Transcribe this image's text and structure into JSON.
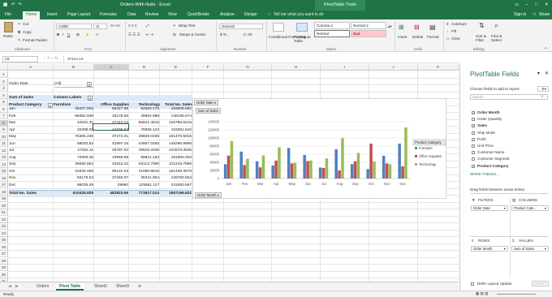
{
  "window": {
    "title": "Orders-With Nulls - Excel",
    "context_tab": "PivotTable Tools",
    "signin": "Sign in",
    "share": "Share"
  },
  "tabs": [
    "File",
    "Home",
    "Insert",
    "Page Layout",
    "Formulas",
    "Data",
    "Review",
    "View",
    "QuickBooks",
    "Analyze",
    "Design"
  ],
  "tell_me": "Tell me what you want to do",
  "ribbon": {
    "clipboard": {
      "paste": "Paste",
      "cut": "Cut",
      "copy": "Copy",
      "format_painter": "Format Painter",
      "group": "Clipboard"
    },
    "font": {
      "name": "Calibri",
      "size": "11",
      "group": "Font"
    },
    "alignment": {
      "wrap": "Wrap Text",
      "merge": "Merge & Center",
      "group": "Alignment"
    },
    "number": {
      "format": "General",
      "group": "Number"
    },
    "styles": {
      "cf": "Conditional Formatting",
      "fat": "Format as Table",
      "comma": "Comma 2",
      "normal2": "Normal 2",
      "normal": "Normal",
      "bad": "Bad",
      "group": "Styles"
    },
    "cells": {
      "insert": "Insert",
      "delete": "Delete",
      "format": "Format",
      "group": "Cells"
    },
    "editing": {
      "autosum": "AutoSum",
      "fill": "Fill",
      "clear": "Clear",
      "sort": "Sort & Filter",
      "find": "Find & Select",
      "group": "Editing"
    }
  },
  "formula_bar": {
    "name_box": "C8",
    "value": "27414.13"
  },
  "columns": [
    "A",
    "B",
    "C",
    "D",
    "E",
    "F",
    "G",
    "H",
    "I",
    "J",
    "K"
  ],
  "rows": [
    "1",
    "2",
    "3",
    "4",
    "5",
    "6",
    "7",
    "8",
    "9",
    "10",
    "11",
    "12",
    "13",
    "14",
    "15",
    "16",
    "17",
    "18",
    "19",
    "20",
    "21",
    "22",
    "23",
    "24",
    "25",
    "26",
    "27",
    "28",
    "29",
    "30",
    "31",
    "32"
  ],
  "pivot": {
    "filter_label": "Order Date",
    "filter_value": "(All)",
    "sum_label": "Sum of Sales",
    "col_labels": "Column Labels",
    "row_label": "Product Category",
    "headers": [
      "Furniture",
      "Office Supplies",
      "Technology",
      "Total No. Sales"
    ],
    "data": [
      [
        "Jan",
        "35407.806",
        "56417.68",
        "92683.176",
        "184508.662"
      ],
      [
        "Feb",
        "66362.936",
        "33178.55",
        "48654.088",
        "148195.574"
      ],
      [
        "Mar",
        "42531.31",
        "27414.13",
        "56841.4615",
        "126786.9215"
      ],
      [
        "Apr",
        "32289.09",
        "44206.63",
        "76906.122",
        "153381.842"
      ],
      [
        "May",
        "75365.236",
        "37274.31",
        "38839.0455",
        "151478.5915"
      ],
      [
        "Jun",
        "58032.82",
        "42897.15",
        "44567.0265",
        "145296.9965"
      ],
      [
        "Jul",
        "27282.11",
        "25787.04",
        "49529.2035",
        "102578.3535"
      ],
      [
        "Aug",
        "72059.46",
        "19969.68",
        "99821.153",
        "191850.293"
      ],
      [
        "Sep",
        "35592.664",
        "42513.42",
        "63112.7055",
        "141218.7895"
      ],
      [
        "Oct",
        "23330.466",
        "86122.03",
        "41986.8615",
        "151439.3575"
      ],
      [
        "Nov",
        "56176.53",
        "37283.07",
        "35321.054",
        "128780.654"
      ],
      [
        "Dec",
        "86035.48",
        "29960",
        "125651.117",
        "241650.597"
      ]
    ],
    "total": [
      "Total No. Sales",
      "610425.928",
      "482823.69",
      "773917.014",
      "1867166.632"
    ]
  },
  "chart_data": {
    "type": "bar",
    "title": "",
    "filter_buttons": [
      "Order Date",
      "Sum of Sales"
    ],
    "axis_button": "Order Month",
    "legend_title": "Product Category",
    "legend_position": "right",
    "categories": [
      "Jan",
      "Feb",
      "Mar",
      "Apr",
      "May",
      "Jun",
      "Jul",
      "Aug",
      "Sep",
      "Oct",
      "Nov",
      "Dec"
    ],
    "ylim": [
      0,
      140000
    ],
    "yticks": [
      "0",
      "20000",
      "40000",
      "60000",
      "80000",
      "100000",
      "120000",
      "140000"
    ],
    "series": [
      {
        "name": "Furniture",
        "color": "#4f81bd",
        "values": [
          35407.806,
          66362.936,
          42531.31,
          32289.09,
          75365.236,
          58032.82,
          27282.11,
          72059.46,
          35592.664,
          23330.466,
          56176.53,
          86035.48
        ]
      },
      {
        "name": "Office Supplies",
        "color": "#c0504d",
        "values": [
          56417.68,
          33178.55,
          27414.13,
          44206.63,
          37274.31,
          42897.15,
          25787.04,
          19969.68,
          42513.42,
          86122.03,
          37283.07,
          29960
        ]
      },
      {
        "name": "Technology",
        "color": "#9bbb59",
        "values": [
          92683.176,
          48654.088,
          56841.4615,
          76906.122,
          38839.0455,
          44567.0265,
          49529.2035,
          99821.153,
          63112.7055,
          41986.8615,
          35321.054,
          125651.117
        ]
      }
    ]
  },
  "sheets": [
    "Orders",
    "Pivot Table",
    "Sheet2",
    "Sheet3"
  ],
  "active_sheet": 1,
  "status": "Ready",
  "pane": {
    "title": "PivotTable Fields",
    "subtitle": "Choose fields to add to report:",
    "search_placeholder": "Search",
    "fields": [
      {
        "name": "Order Month",
        "checked": true
      },
      {
        "name": "Order Quantity",
        "checked": false
      },
      {
        "name": "Sales",
        "checked": true
      },
      {
        "name": "Ship Mode",
        "checked": false
      },
      {
        "name": "Profit",
        "checked": false
      },
      {
        "name": "Unit Price",
        "checked": false
      },
      {
        "name": "Customer Name",
        "checked": false
      },
      {
        "name": "Customer Segment",
        "checked": false
      },
      {
        "name": "Product Category",
        "checked": true
      }
    ],
    "more_tables": "MORE TABLES...",
    "drag_hint": "Drag fields between areas below:",
    "filters_label": "FILTERS",
    "columns_label": "COLUMNS",
    "rows_label": "ROWS",
    "values_label": "VALUES",
    "filters_item": "Order Date",
    "columns_item": "Product Cate...",
    "rows_item": "Order Month",
    "values_item": "Sum of Sales",
    "defer": "Defer Layout Update",
    "update": "UPDATE"
  }
}
